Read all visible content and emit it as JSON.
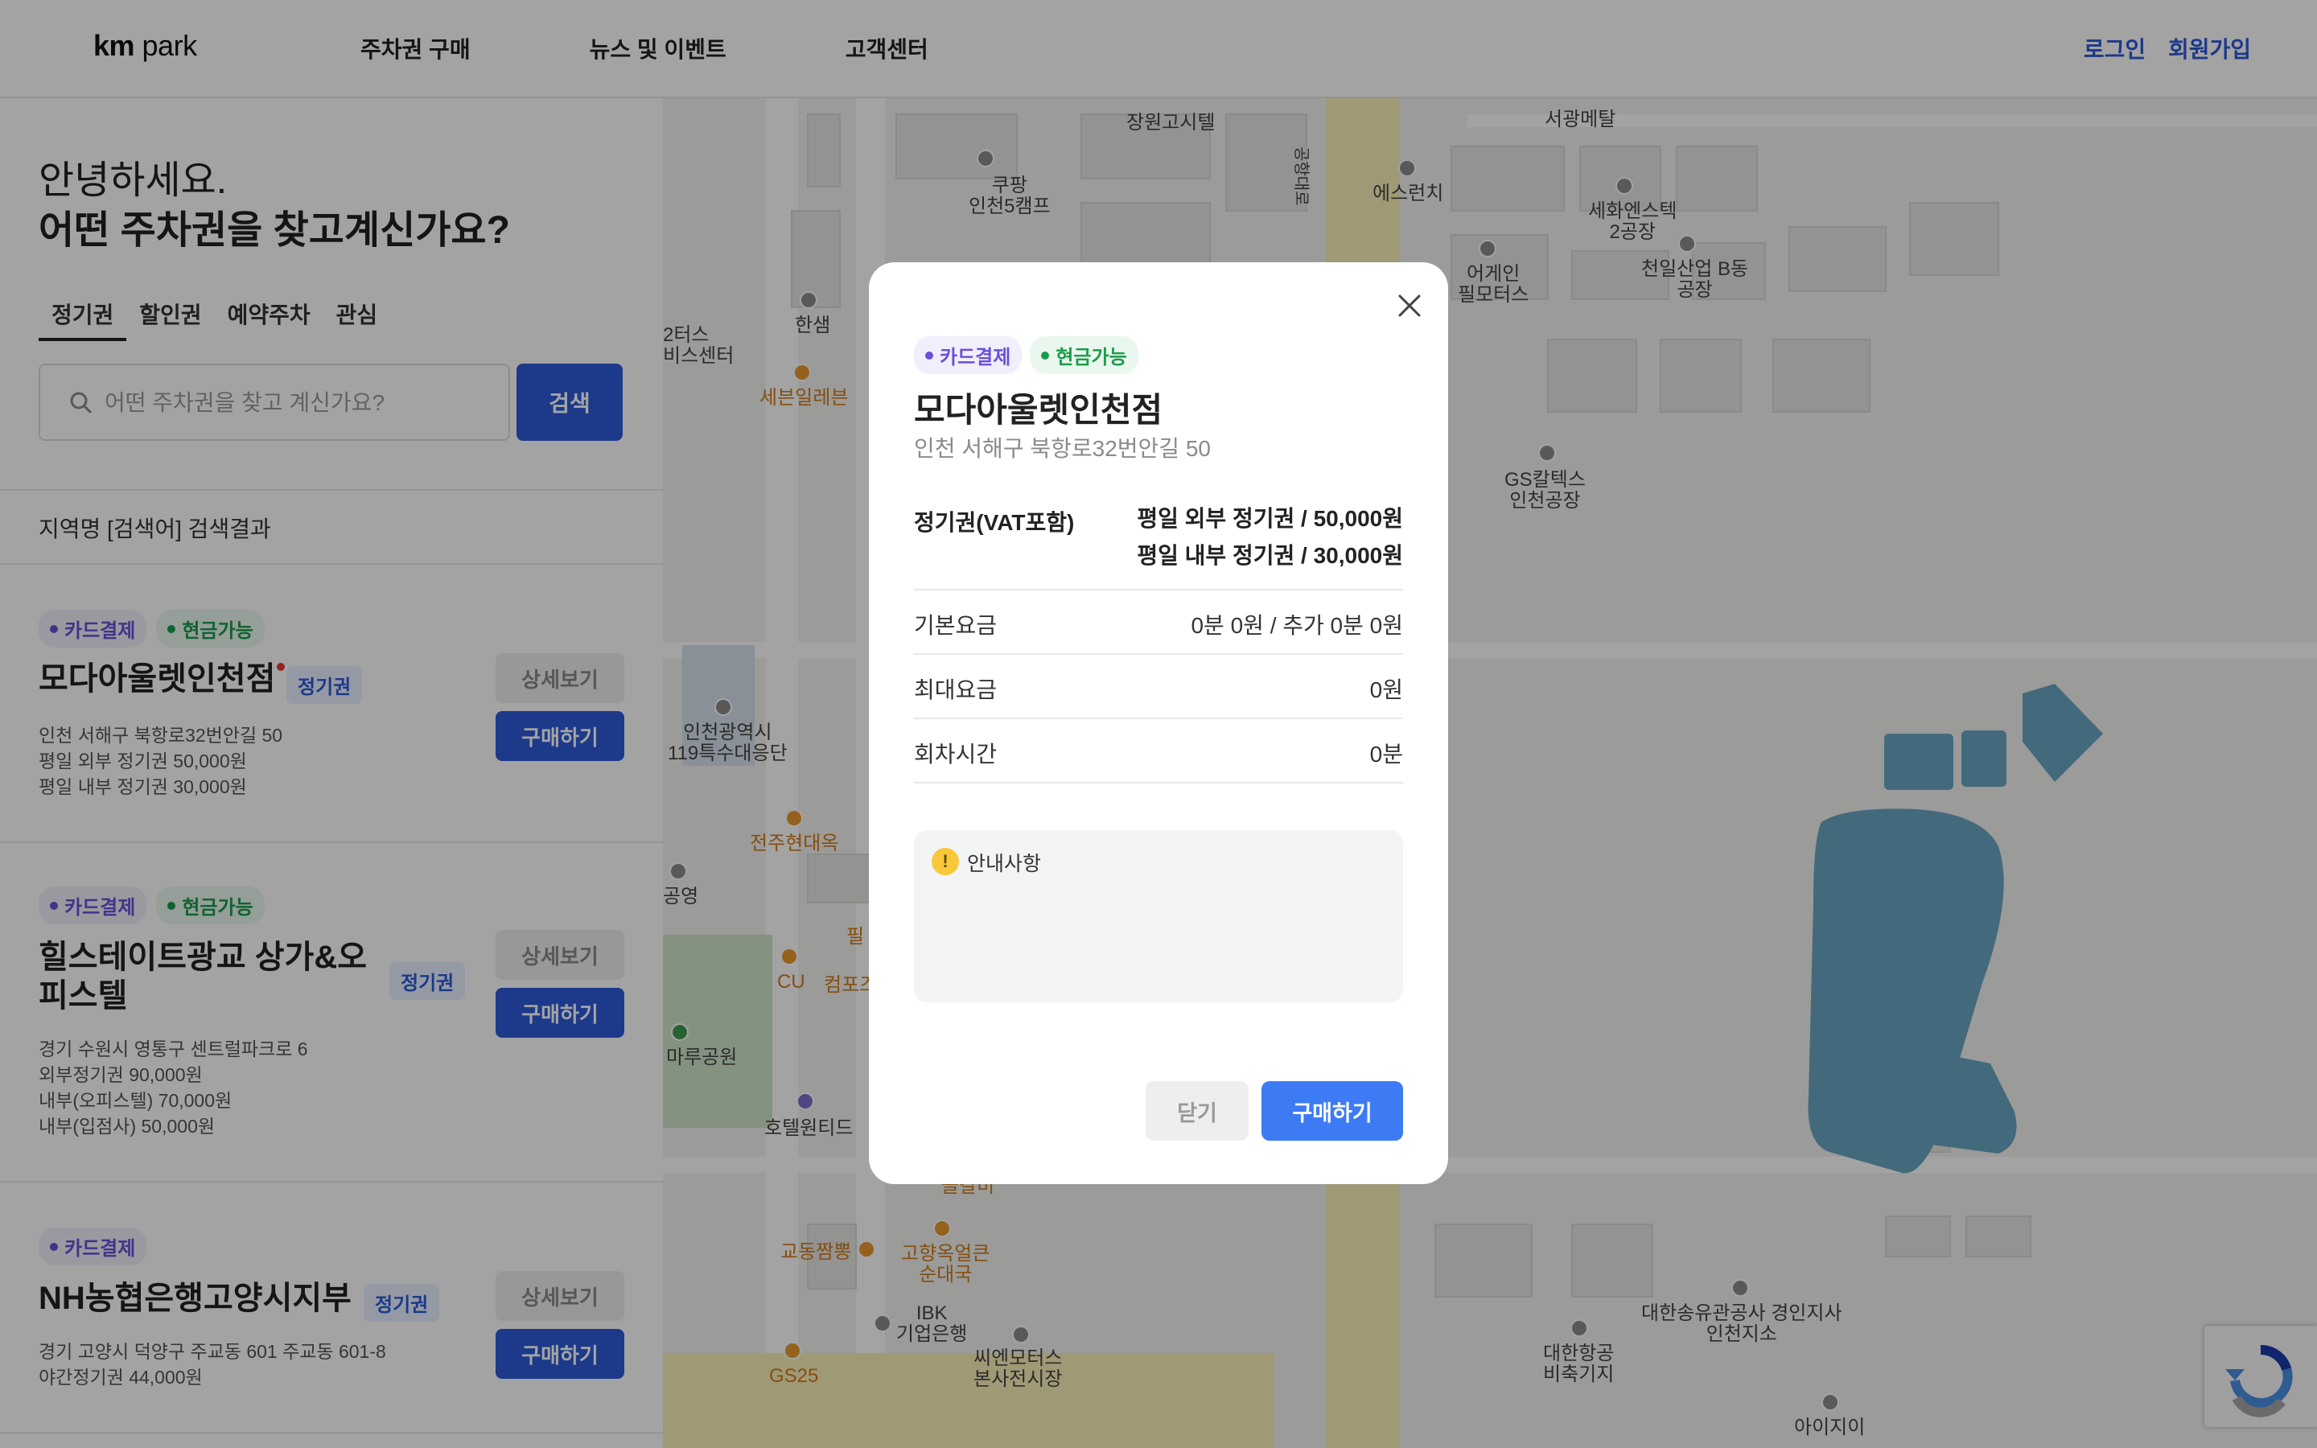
{
  "header": {
    "logo_bold": "km",
    "logo_rest": " park",
    "nav": [
      "주차권 구매",
      "뉴스 및 이벤트",
      "고객센터"
    ],
    "login": "로그인",
    "signup": "회원가입"
  },
  "sidebar": {
    "greeting": "안녕하세요.",
    "question": "어떤 주차권을 찾고계신가요?",
    "tabs": [
      "정기권",
      "할인권",
      "예약주차",
      "관심"
    ],
    "search_placeholder": "어떤 주차권을 찾고 계신가요?",
    "search_button": "검색",
    "result_title": "지역명 [검색어] 검색결과",
    "detail_label": "상세보기",
    "buy_label": "구매하기",
    "badge_card": "카드결제",
    "badge_cash": "현금가능",
    "type_tag": "정기권",
    "results": [
      {
        "name": "모다아울렛인천점",
        "lines": [
          "인천 서해구 북항로32번안길 50",
          "평일 외부 정기권 50,000원",
          "평일 내부 정기권 30,000원"
        ]
      },
      {
        "name_line1": "힐스테이트광교 상가&오",
        "name_line2": "피스텔",
        "lines": [
          "경기 수원시 영통구 센트럴파크로 6",
          "외부정기권 90,000원",
          "내부(오피스텔) 70,000원",
          "내부(입점사) 50,000원"
        ]
      },
      {
        "name": "NH농협은행고양시지부",
        "lines": [
          "경기 고양시 덕양구 주교동 601 주교동 601-8",
          "야간정기권 44,000원"
        ]
      }
    ]
  },
  "map": {
    "labels": [
      "장원고시텔",
      "서광메탈",
      "쿠팡",
      "인천5캠프",
      "에스런치",
      "세화엔스텍",
      "2공장",
      "천일산업 B동",
      "공장",
      "어게인",
      "필모터스",
      "한샘",
      "2터스",
      "비스센터",
      "세븐일레븐",
      "GS칼텍스",
      "인천공장",
      "인천광역시",
      "119특수대응단",
      "전주현대옥",
      "공영",
      "CU",
      "컴포즈",
      "필",
      "마루공원",
      "호텔원티드",
      "놀갈비",
      "교동짬뽕",
      "고향옥얼큰",
      "순대국",
      "IBK",
      "기업은행",
      "씨엔모터스",
      "본사전시장",
      "GS25",
      "대한항공",
      "비축기지",
      "대한송유관공사 경인지사",
      "인천지소",
      "아이지이",
      "공항대로"
    ]
  },
  "modal": {
    "badge_card": "카드결제",
    "badge_cash": "현금가능",
    "title": "모다아울렛인천점",
    "address": "인천 서해구 북항로32번안길 50",
    "pass_label": "정기권(VAT포함)",
    "pass_values": [
      "평일 외부 정기권 / 50,000원",
      "평일 내부 정기권 / 30,000원"
    ],
    "rows": [
      {
        "label": "기본요금",
        "value": "0분 0원 / 추가 0분 0원"
      },
      {
        "label": "최대요금",
        "value": "0원"
      },
      {
        "label": "회차시간",
        "value": "0분"
      }
    ],
    "notice_icon": "!",
    "notice_title": "안내사항",
    "close_label": "닫기",
    "buy_label": "구매하기"
  },
  "colors": {
    "primary": "#2c59d8",
    "modal_buy": "#3d7bf5",
    "card_badge": "#6b4fd8",
    "cash_badge": "#1a9c4a",
    "overlay": "rgba(0,0,0,0.36)"
  },
  "icons": [
    "search-icon",
    "close-icon",
    "warning-icon",
    "recaptcha-icon"
  ]
}
